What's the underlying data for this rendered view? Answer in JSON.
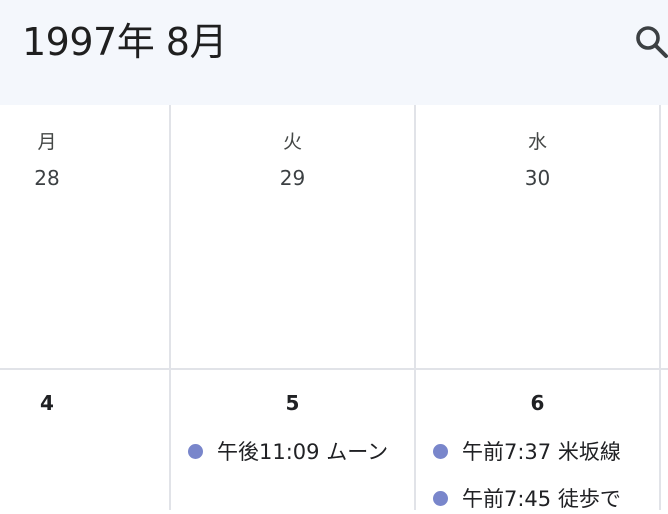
{
  "header": {
    "month_title": "1997年 8月"
  },
  "week1": {
    "days": [
      {
        "dow": "月",
        "num": "28"
      },
      {
        "dow": "火",
        "num": "29"
      },
      {
        "dow": "水",
        "num": "30"
      }
    ]
  },
  "week2": {
    "days": [
      {
        "num": "4",
        "events": []
      },
      {
        "num": "5",
        "events": [
          {
            "text": "午後11:09 ムーン"
          }
        ]
      },
      {
        "num": "6",
        "events": [
          {
            "text": "午前7:37 米坂線"
          },
          {
            "text": "午前7:45 徒歩で"
          }
        ]
      }
    ]
  },
  "colors": {
    "header_bg": "#f4f7fc",
    "grid_line": "#e1e3e8",
    "event_dot": "#7986cb"
  },
  "icons": {
    "search": "search-icon"
  }
}
